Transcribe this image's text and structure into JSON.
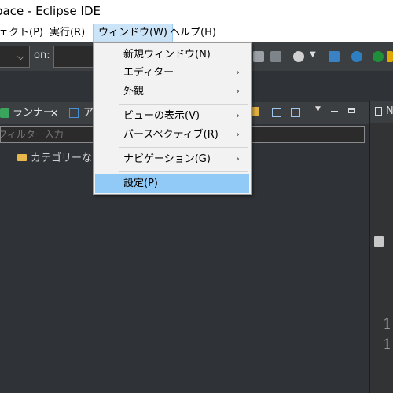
{
  "window": {
    "title": "pace - Eclipse IDE"
  },
  "menubar": {
    "items": [
      {
        "label": "ェクト(P)"
      },
      {
        "label": "実行(R)"
      },
      {
        "label": "ウィンドウ(W)"
      },
      {
        "label": "ヘルプ(H)"
      }
    ]
  },
  "toolbar": {
    "on_label": "on:",
    "on_value": "---"
  },
  "tabs": {
    "runner": "ランナー",
    "close": "✕",
    "second": "ア",
    "right": "N"
  },
  "filter": {
    "placeholder": "フィルター入力"
  },
  "tree": {
    "item": "カテゴリーなし"
  },
  "window_menu": {
    "items": [
      {
        "label": "新規ウィンドウ(N)",
        "submenu": false
      },
      {
        "label": "エディター",
        "submenu": true
      },
      {
        "label": "外観",
        "submenu": true
      },
      {
        "label": "ビューの表示(V)",
        "submenu": true
      },
      {
        "label": "パースペクティブ(R)",
        "submenu": true
      },
      {
        "label": "ナビゲーション(G)",
        "submenu": true
      },
      {
        "label": "設定(P)",
        "submenu": false,
        "selected": true
      }
    ],
    "arrow": "›"
  },
  "editor": {
    "line_numbers": [
      "1",
      "1"
    ]
  },
  "colors": {
    "selection": "#91c9f7",
    "menu_bg": "#f2f2f2",
    "dark_bg": "#2f3337"
  }
}
